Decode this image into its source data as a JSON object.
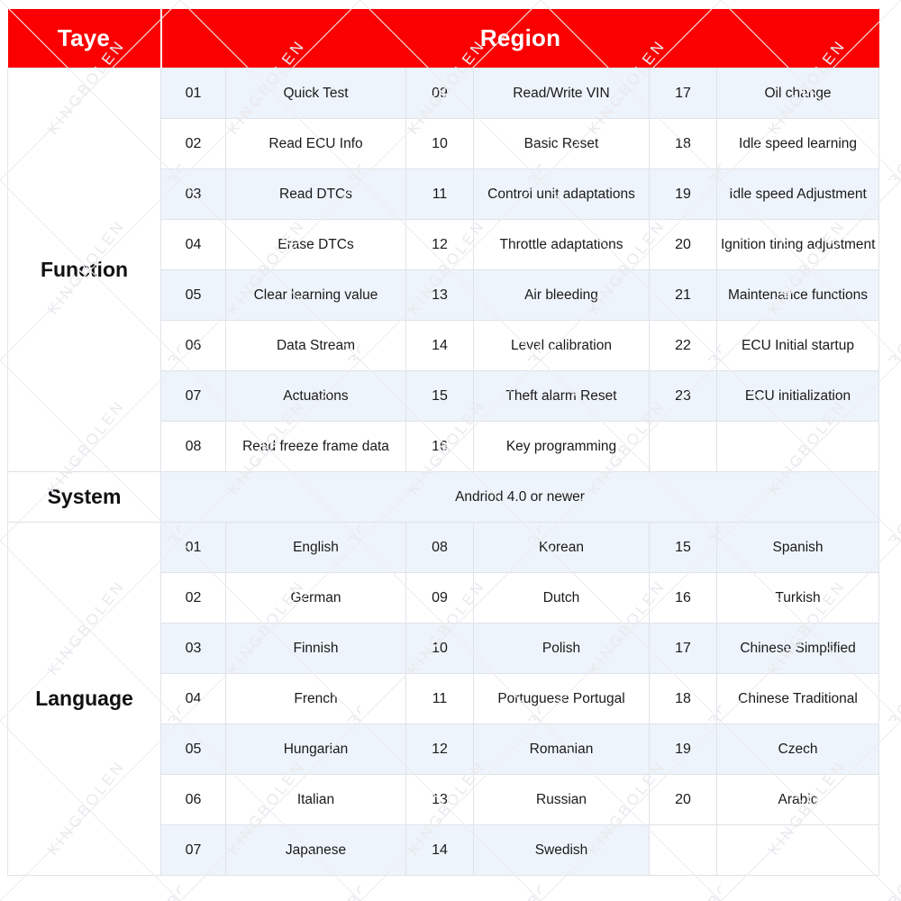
{
  "header": {
    "col_label": "Taye",
    "col_region": "Region"
  },
  "colors": {
    "header_red": "#fb0000",
    "header_text": "#ffffff",
    "row_shade": "#eef4fb",
    "row_plain": "#ffffff",
    "grid_line": "#dfe3e8",
    "body_text": "#1a1a1a"
  },
  "watermark": {
    "text": "KINGBOLEN"
  },
  "sections": [
    {
      "label": "Function",
      "rows": [
        {
          "n1": "01",
          "t1": "Quick Test",
          "n2": "09",
          "t2": "Read/Write VIN",
          "n3": "17",
          "t3": "Oil change"
        },
        {
          "n1": "02",
          "t1": "Read ECU Info",
          "n2": "10",
          "t2": "Basic Reset",
          "n3": "18",
          "t3": "Idle speed learning"
        },
        {
          "n1": "03",
          "t1": "Read DTCs",
          "n2": "11",
          "t2": "Control unit adaptations",
          "n3": "19",
          "t3": "Idle speed Adjustment"
        },
        {
          "n1": "04",
          "t1": "Erase DTCs",
          "n2": "12",
          "t2": "Throttle adaptations",
          "n3": "20",
          "t3": "Ignition tining adjustment"
        },
        {
          "n1": "05",
          "t1": "Clear learning value",
          "n2": "13",
          "t2": "Air bleeding",
          "n3": "21",
          "t3": "Maintenance functions"
        },
        {
          "n1": "06",
          "t1": "Data Stream",
          "n2": "14",
          "t2": "Level calibration",
          "n3": "22",
          "t3": "ECU Initial startup"
        },
        {
          "n1": "07",
          "t1": "Actuations",
          "n2": "15",
          "t2": "Theft alarm Reset",
          "n3": "23",
          "t3": "ECU initialization"
        },
        {
          "n1": "08",
          "t1": "Read freeze frame data",
          "n2": "16",
          "t2": "Key programming",
          "n3": "",
          "t3": ""
        }
      ]
    },
    {
      "label": "System",
      "merged_value": "Andriod 4.0 or newer"
    },
    {
      "label": "Language",
      "rows": [
        {
          "n1": "01",
          "t1": "English",
          "n2": "08",
          "t2": "Korean",
          "n3": "15",
          "t3": "Spanish"
        },
        {
          "n1": "02",
          "t1": "German",
          "n2": "09",
          "t2": "Dutch",
          "n3": "16",
          "t3": "Turkish"
        },
        {
          "n1": "03",
          "t1": "Finnish",
          "n2": "10",
          "t2": "Polish",
          "n3": "17",
          "t3": "Chinese Simplified"
        },
        {
          "n1": "04",
          "t1": "French",
          "n2": "11",
          "t2": "Portuguese Portugal",
          "n3": "18",
          "t3": "Chinese Traditional"
        },
        {
          "n1": "05",
          "t1": "Hungarian",
          "n2": "12",
          "t2": "Romanian",
          "n3": "19",
          "t3": "Czech"
        },
        {
          "n1": "06",
          "t1": "Italian",
          "n2": "13",
          "t2": "Russian",
          "n3": "20",
          "t3": "Arabic"
        },
        {
          "n1": "07",
          "t1": "Japanese",
          "n2": "14",
          "t2": "Swedish",
          "n3": "",
          "t3": ""
        }
      ]
    }
  ]
}
